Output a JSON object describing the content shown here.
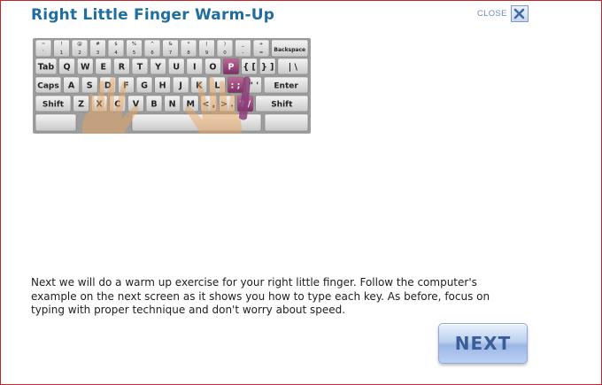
{
  "header": {
    "title": "Right Little Finger Warm-Up",
    "close_label": "CLOSE"
  },
  "keyboard": {
    "number_row": [
      {
        "top": "~",
        "bottom": "`"
      },
      {
        "top": "!",
        "bottom": "1"
      },
      {
        "top": "@",
        "bottom": "2"
      },
      {
        "top": "#",
        "bottom": "3"
      },
      {
        "top": "$",
        "bottom": "4"
      },
      {
        "top": "%",
        "bottom": "5"
      },
      {
        "top": "^",
        "bottom": "6"
      },
      {
        "top": "&",
        "bottom": "7"
      },
      {
        "top": "*",
        "bottom": "8"
      },
      {
        "top": "(",
        "bottom": "9"
      },
      {
        "top": ")",
        "bottom": "0"
      },
      {
        "top": "_",
        "bottom": "-"
      },
      {
        "top": "+",
        "bottom": "="
      }
    ],
    "backspace": "Backspace",
    "row_q": [
      "Tab",
      "Q",
      "W",
      "E",
      "R",
      "T",
      "Y",
      "U",
      "I",
      "O",
      "P",
      "{ [",
      "} ]",
      "| \\"
    ],
    "row_a": [
      "Caps",
      "A",
      "S",
      "D",
      "F",
      "G",
      "H",
      "J",
      "K",
      "L",
      ": ;",
      "\" '",
      "Enter"
    ],
    "row_z": [
      "Shift",
      "Z",
      "X",
      "C",
      "V",
      "B",
      "N",
      "M",
      "< ,",
      "> .",
      "? /",
      "Shift"
    ],
    "highlight_color": "#9c4a7d"
  },
  "instructions": "Next we will do a warm up exercise for your right little finger. Follow the computer's example on the next screen as it shows you how to type each key. As before, focus on typing with proper technique and don't worry about speed.",
  "next_label": "NEXT",
  "colors": {
    "title": "#1f6e9f",
    "border": "#c0262b",
    "next_text": "#3b5e98"
  }
}
